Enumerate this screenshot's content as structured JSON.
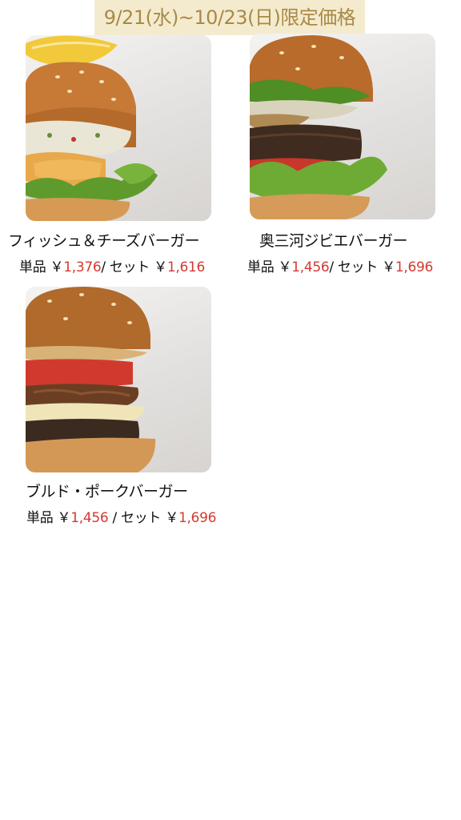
{
  "banner": {
    "text": "9/21(水)~10/23(日)限定価格"
  },
  "items": [
    {
      "name": "フィッシュ＆チーズバーガー",
      "single_label": "単品 ￥",
      "single_price": "1,376",
      "set_label": "/ セット ￥",
      "set_price": "1,616"
    },
    {
      "name": "奥三河ジビエバーガー",
      "single_label": "単品 ￥",
      "single_price": "1,456",
      "set_label": "/ セット ￥",
      "set_price": "1,696"
    },
    {
      "name": "ブルド・ポークバーガー",
      "single_label": "単品 ￥",
      "single_price": "1,456",
      "set_label": " / セット ￥",
      "set_price": "1,696"
    }
  ],
  "colors": {
    "banner_bg": "#f4ebcf",
    "banner_text": "#a88a45",
    "price_accent": "#d43a30"
  },
  "icons": [
    "burger-photo"
  ]
}
